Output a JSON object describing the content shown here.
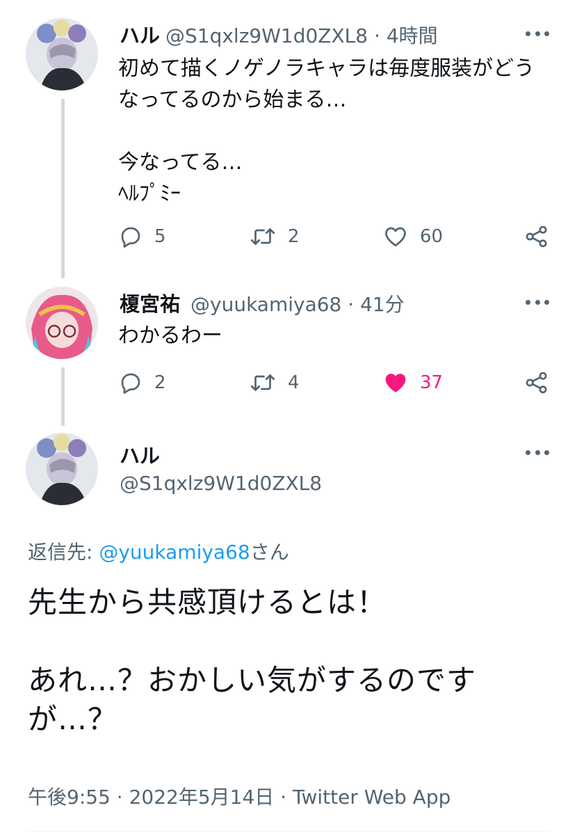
{
  "tweet1": {
    "name": "ハル",
    "handle": "@S1qxlz9W1d0ZXL8",
    "time": "4時間",
    "body": "初めて描くノゲノラキャラは毎度服装がどうなってるのから始まる…\n\n今なってる…\nﾍﾙﾌﾟﾐｰ",
    "replies": "5",
    "retweets": "2",
    "likes": "60"
  },
  "tweet2": {
    "name": "榎宮祐",
    "handle": "@yuukamiya68",
    "time": "41分",
    "body": "わかるわー",
    "replies": "2",
    "retweets": "4",
    "likes": "37"
  },
  "main_tweet": {
    "name": "ハル",
    "handle": "@S1qxlz9W1d0ZXL8",
    "reply_prefix": "返信先: ",
    "reply_mention": "@yuukamiya68",
    "reply_suffix": "さん",
    "body": "先生から共感頂けるとは！\n\nあれ…？おかしい気がするのですが…？",
    "timestamp": "午後9:55 · 2022年5月14日 · Twitter Web App"
  },
  "separator": "·",
  "colors": {
    "like_active": "#f91880",
    "link": "#1d9bf0",
    "secondary_text": "#536471",
    "thread_line": "#cfd9de"
  },
  "icons": [
    "more-icon",
    "reply-icon",
    "retweet-icon",
    "like-icon",
    "like-filled-icon",
    "share-icon"
  ]
}
